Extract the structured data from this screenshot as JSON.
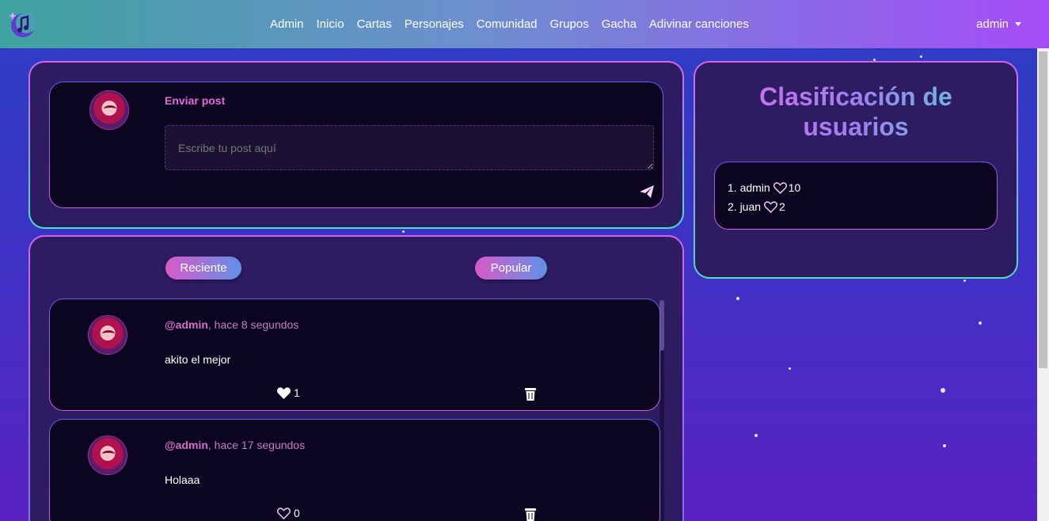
{
  "navbar": {
    "links": [
      "Admin",
      "Inicio",
      "Cartas",
      "Personajes",
      "Comunidad",
      "Grupos",
      "Gacha",
      "Adivinar canciones"
    ],
    "user": "admin"
  },
  "composer": {
    "title": "Enviar post",
    "placeholder": "Escribe tu post aquí"
  },
  "tabs": {
    "recent": "Reciente",
    "popular": "Popular"
  },
  "posts": [
    {
      "user": "@admin",
      "time": ", hace 8 segundos",
      "body": "akito el mejor",
      "likes": "1",
      "liked": true
    },
    {
      "user": "@admin",
      "time": ", hace 17 segundos",
      "body": "Holaaa",
      "likes": "0",
      "liked": false
    }
  ],
  "ranking": {
    "title_line1": "Clasificación de",
    "title_line2": "usuarios",
    "items": [
      {
        "label": "1. admin",
        "score": "10"
      },
      {
        "label": "2. juan",
        "score": "2"
      }
    ]
  },
  "colors": {
    "accent_pink": "#d85ac8",
    "accent_teal": "#46e0c7",
    "card_bg": "#0b0520"
  }
}
